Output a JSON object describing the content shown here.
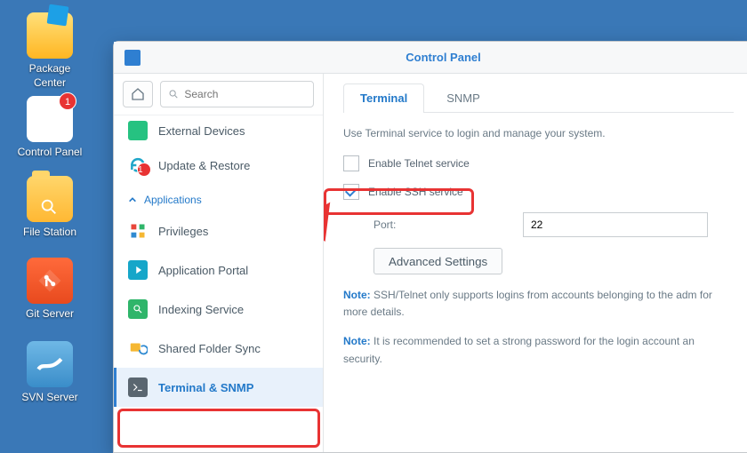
{
  "desktop": {
    "icons": [
      {
        "name": "package-center",
        "label": "Package\nCenter"
      },
      {
        "name": "control-panel",
        "label": "Control Panel",
        "badge": "1"
      },
      {
        "name": "file-station",
        "label": "File Station"
      },
      {
        "name": "git-server",
        "label": "Git Server"
      },
      {
        "name": "svn-server",
        "label": "SVN Server"
      }
    ]
  },
  "window": {
    "title": "Control Panel",
    "search_placeholder": "Search"
  },
  "sidebar": {
    "section": "Applications",
    "items": [
      {
        "id": "external-devices",
        "label": "External Devices"
      },
      {
        "id": "update-restore",
        "label": "Update & Restore",
        "badge": "1"
      },
      {
        "id": "privileges",
        "label": "Privileges"
      },
      {
        "id": "application-portal",
        "label": "Application Portal"
      },
      {
        "id": "indexing-service",
        "label": "Indexing Service"
      },
      {
        "id": "shared-folder-sync",
        "label": "Shared Folder Sync"
      },
      {
        "id": "terminal-snmp",
        "label": "Terminal & SNMP"
      }
    ]
  },
  "tabs": {
    "terminal": "Terminal",
    "snmp": "SNMP"
  },
  "terminal": {
    "desc": "Use Terminal service to login and manage your system.",
    "telnet_label": "Enable Telnet service",
    "ssh_label": "Enable SSH service",
    "port_label": "Port:",
    "port_value": "22",
    "advanced": "Advanced Settings",
    "note1_prefix": "Note:",
    "note1": " SSH/Telnet only supports logins from accounts belonging to the adm for more details.",
    "note2_prefix": "Note:",
    "note2": " It is recommended to set a strong password for the login account an security."
  }
}
